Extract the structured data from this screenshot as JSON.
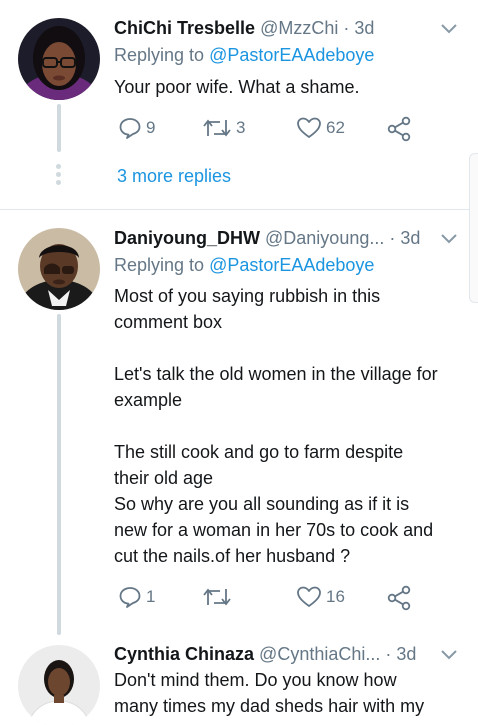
{
  "tweets": [
    {
      "name": "ChiChi Tresbelle",
      "handle": "@MzzChi",
      "time": "3d",
      "replying_prefix": "Replying to ",
      "replying_to": "@PastorEAAdeboye",
      "text": "Your poor wife. What a shame.",
      "replies": "9",
      "retweets": "3",
      "likes": "62",
      "more_replies": "3 more replies"
    },
    {
      "name": "Daniyoung_DHW",
      "handle": "@Daniyoung...",
      "time": "3d",
      "replying_prefix": "Replying to ",
      "replying_to": "@PastorEAAdeboye",
      "text": "Most of you saying rubbish in this\ncomment box\n\nLet's talk the old women in the village for\nexample\n\nThe still cook and go to farm despite\ntheir old age\nSo why are you all sounding as if it is\nnew for a woman in her 70s to cook and\ncut the nails.of her husband ?",
      "replies": "1",
      "retweets": "",
      "likes": "16"
    },
    {
      "name": "Cynthia Chinaza",
      "handle": "@CynthiaChi...",
      "time": "3d",
      "text": "Don't mind them. Do you know how\nmany times my dad sheds hair with my"
    }
  ],
  "icons": {
    "reply": "reply-icon",
    "retweet": "retweet-icon",
    "like": "heart-icon",
    "share": "share-icon",
    "menu": "chevron-down-icon"
  },
  "colors": {
    "link": "#1b95e0",
    "secondary": "#657786",
    "thread_line": "#cfd9de"
  }
}
